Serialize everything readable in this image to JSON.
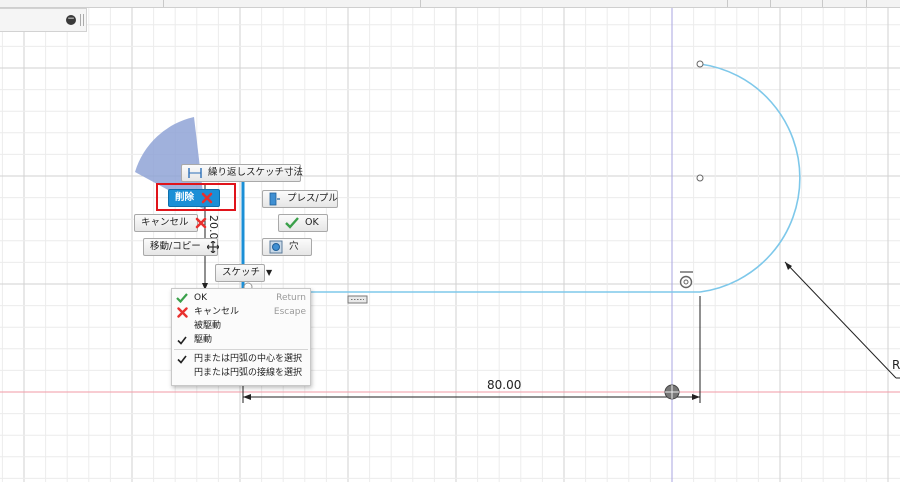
{
  "marking_menu": {
    "repeat_dimension_label": "繰り返しスケッチ寸法",
    "delete_label": "削除",
    "press_pull_label": "プレス/プル",
    "cancel_label": "キャンセル",
    "ok_label": "OK",
    "move_copy_label": "移動/コピー",
    "hole_label": "穴",
    "sketch_label": "スケッチ"
  },
  "context_menu": {
    "ok_label": "OK",
    "ok_shortcut": "Return",
    "cancel_label": "キャンセル",
    "cancel_shortcut": "Escape",
    "driven_label": "被駆動",
    "driving_label": "駆動",
    "select_center_label": "円または円弧の中心を選択",
    "select_tangent_label": "円または円弧の接線を選択"
  },
  "dimensions": {
    "horizontal_value": "80.00",
    "vertical_value": "20.0",
    "radius_prefix": "R"
  },
  "colors": {
    "sketch_line": "#7ec8ea",
    "selection_blue": "#1b8fd6",
    "highlight_red": "#e0141b",
    "marking_menu_wedge": "#8fa3d6"
  }
}
